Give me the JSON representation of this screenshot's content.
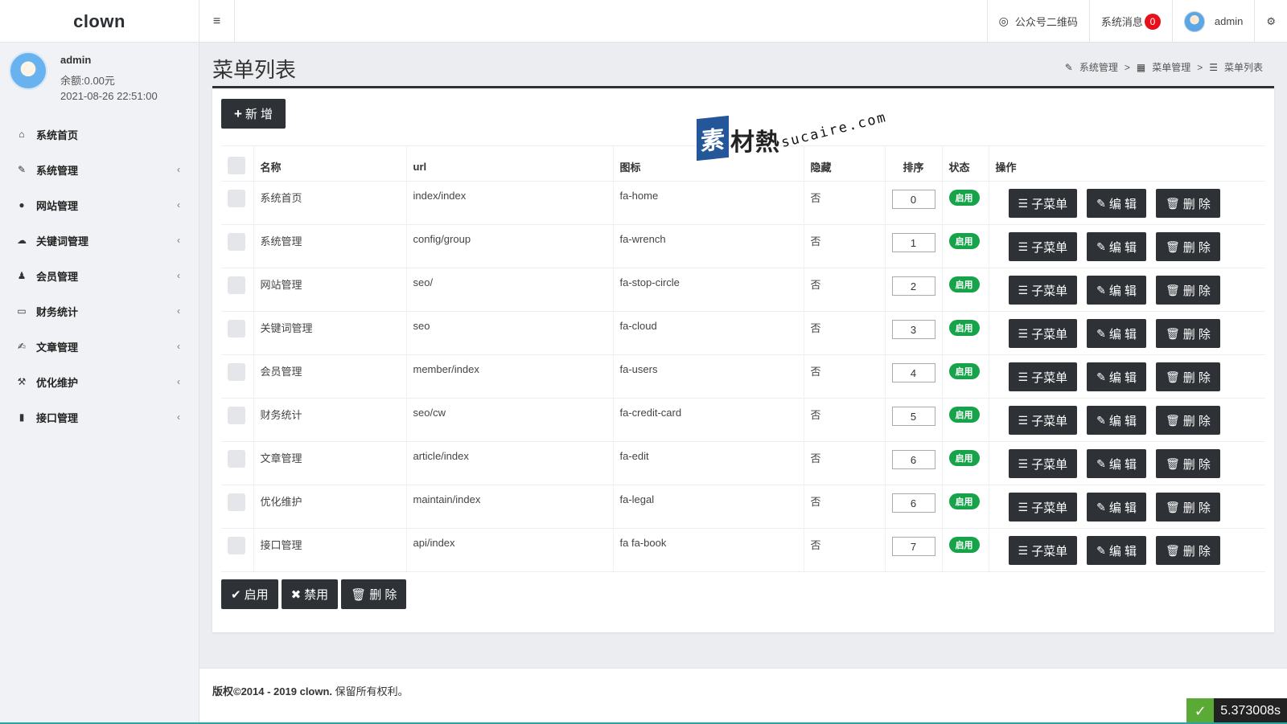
{
  "header": {
    "brand": "clown",
    "menu_toggle_icon": "bars-icon",
    "wechat_label": "公众号二维码",
    "messages_label": "系统消息",
    "messages_count": "0",
    "user_name": "admin"
  },
  "profile": {
    "name": "admin",
    "balance": "余额:0.00元",
    "time": "2021-08-26 22:51:00"
  },
  "sidebar": {
    "items": [
      {
        "label": "系统首页",
        "icon": "home-icon",
        "glyph": "⌂",
        "chevron": ""
      },
      {
        "label": "系统管理",
        "icon": "wrench-icon",
        "glyph": "✎",
        "chevron": "‹"
      },
      {
        "label": "网站管理",
        "icon": "stop-circle-icon",
        "glyph": "●",
        "chevron": "‹"
      },
      {
        "label": "关键词管理",
        "icon": "cloud-icon",
        "glyph": "☁",
        "chevron": "‹"
      },
      {
        "label": "会员管理",
        "icon": "users-icon",
        "glyph": "♟",
        "chevron": "‹"
      },
      {
        "label": "财务统计",
        "icon": "credit-card-icon",
        "glyph": "▭",
        "chevron": "‹"
      },
      {
        "label": "文章管理",
        "icon": "edit-icon",
        "glyph": "✍",
        "chevron": "‹"
      },
      {
        "label": "优化维护",
        "icon": "legal-icon",
        "glyph": "⚒",
        "chevron": "‹"
      },
      {
        "label": "接口管理",
        "icon": "book-icon",
        "glyph": "▮",
        "chevron": "‹"
      }
    ]
  },
  "page": {
    "title": "菜单列表",
    "breadcrumb": [
      "系统管理",
      "菜单管理",
      "菜单列表"
    ],
    "breadcrumb_sep": ">",
    "add_label": "新 增"
  },
  "table": {
    "headers": [
      "名称",
      "url",
      "图标",
      "隐藏",
      "排序",
      "状态",
      "操作"
    ],
    "rows": [
      {
        "name": "系统首页",
        "url": "index/index",
        "icon": "fa-home",
        "hidden": "否",
        "order": "0",
        "status": "启用"
      },
      {
        "name": "系统管理",
        "url": "config/group",
        "icon": "fa-wrench",
        "hidden": "否",
        "order": "1",
        "status": "启用"
      },
      {
        "name": "网站管理",
        "url": "seo/",
        "icon": "fa-stop-circle",
        "hidden": "否",
        "order": "2",
        "status": "启用"
      },
      {
        "name": "关键词管理",
        "url": "seo",
        "icon": "fa-cloud",
        "hidden": "否",
        "order": "3",
        "status": "启用"
      },
      {
        "name": "会员管理",
        "url": "member/index",
        "icon": "fa-users",
        "hidden": "否",
        "order": "4",
        "status": "启用"
      },
      {
        "name": "财务统计",
        "url": "seo/cw",
        "icon": "fa-credit-card",
        "hidden": "否",
        "order": "5",
        "status": "启用"
      },
      {
        "name": "文章管理",
        "url": "article/index",
        "icon": "fa-edit",
        "hidden": "否",
        "order": "6",
        "status": "启用"
      },
      {
        "name": "优化维护",
        "url": "maintain/index",
        "icon": "fa-legal",
        "hidden": "否",
        "order": "6",
        "status": "启用"
      },
      {
        "name": "接口管理",
        "url": "api/index",
        "icon": "fa fa-book",
        "hidden": "否",
        "order": "7",
        "status": "启用"
      }
    ],
    "actions": {
      "submenu": "子菜单",
      "edit": "编 辑",
      "delete": "删 除"
    }
  },
  "bulk": {
    "enable": "启用",
    "disable": "禁用",
    "delete": "删 除"
  },
  "watermark": {
    "mark": "素",
    "cn": "材熱",
    "en": "sucaire.com"
  },
  "footer": {
    "copyright_prefix": "版权©2014 - 2019 clown.",
    "copyright_suffix": "保留所有权利。",
    "timer": "5.373008s"
  },
  "colors": {
    "dark": "#2e3237",
    "status_green": "#17a34a",
    "badge_red": "#e8101b",
    "watermark_blue": "#24569a"
  }
}
